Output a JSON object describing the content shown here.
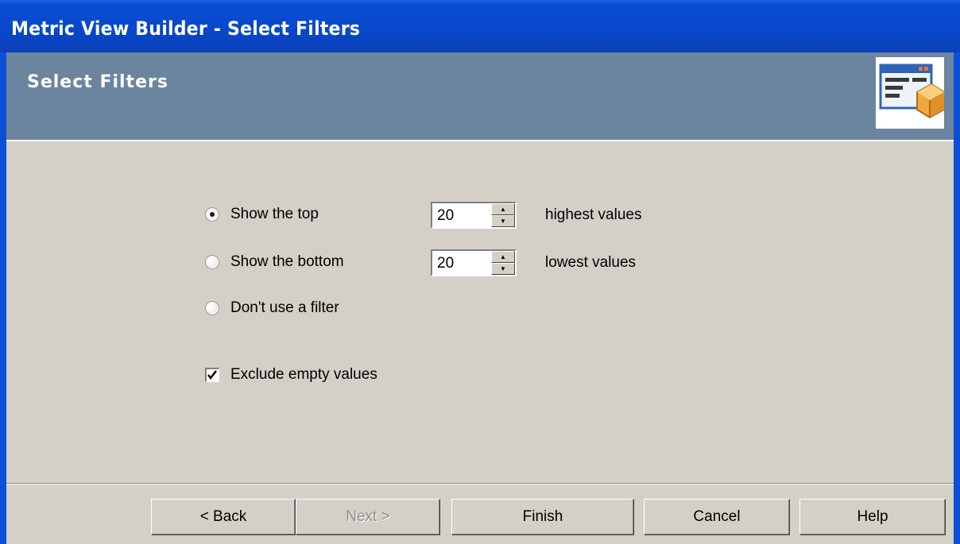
{
  "window": {
    "title": "Metric View Builder - Select Filters"
  },
  "header": {
    "title": "Select Filters",
    "icon": "wizard-box-icon"
  },
  "filters": {
    "top": {
      "label": "Show the top",
      "value": "20",
      "suffix": "highest values",
      "selected": true
    },
    "bottom": {
      "label": "Show the bottom",
      "value": "20",
      "suffix": "lowest values",
      "selected": false
    },
    "none": {
      "label": "Don't use a filter",
      "selected": false
    },
    "exclude_empty": {
      "label": "Exclude empty values",
      "checked": true
    }
  },
  "buttons": {
    "back": "< Back",
    "next": "Next >",
    "finish": "Finish",
    "cancel": "Cancel",
    "help": "Help"
  },
  "colors": {
    "titlebar": "#0a4fd5",
    "header_band": "#6b859f",
    "dialog_face": "#d4d0c8"
  }
}
